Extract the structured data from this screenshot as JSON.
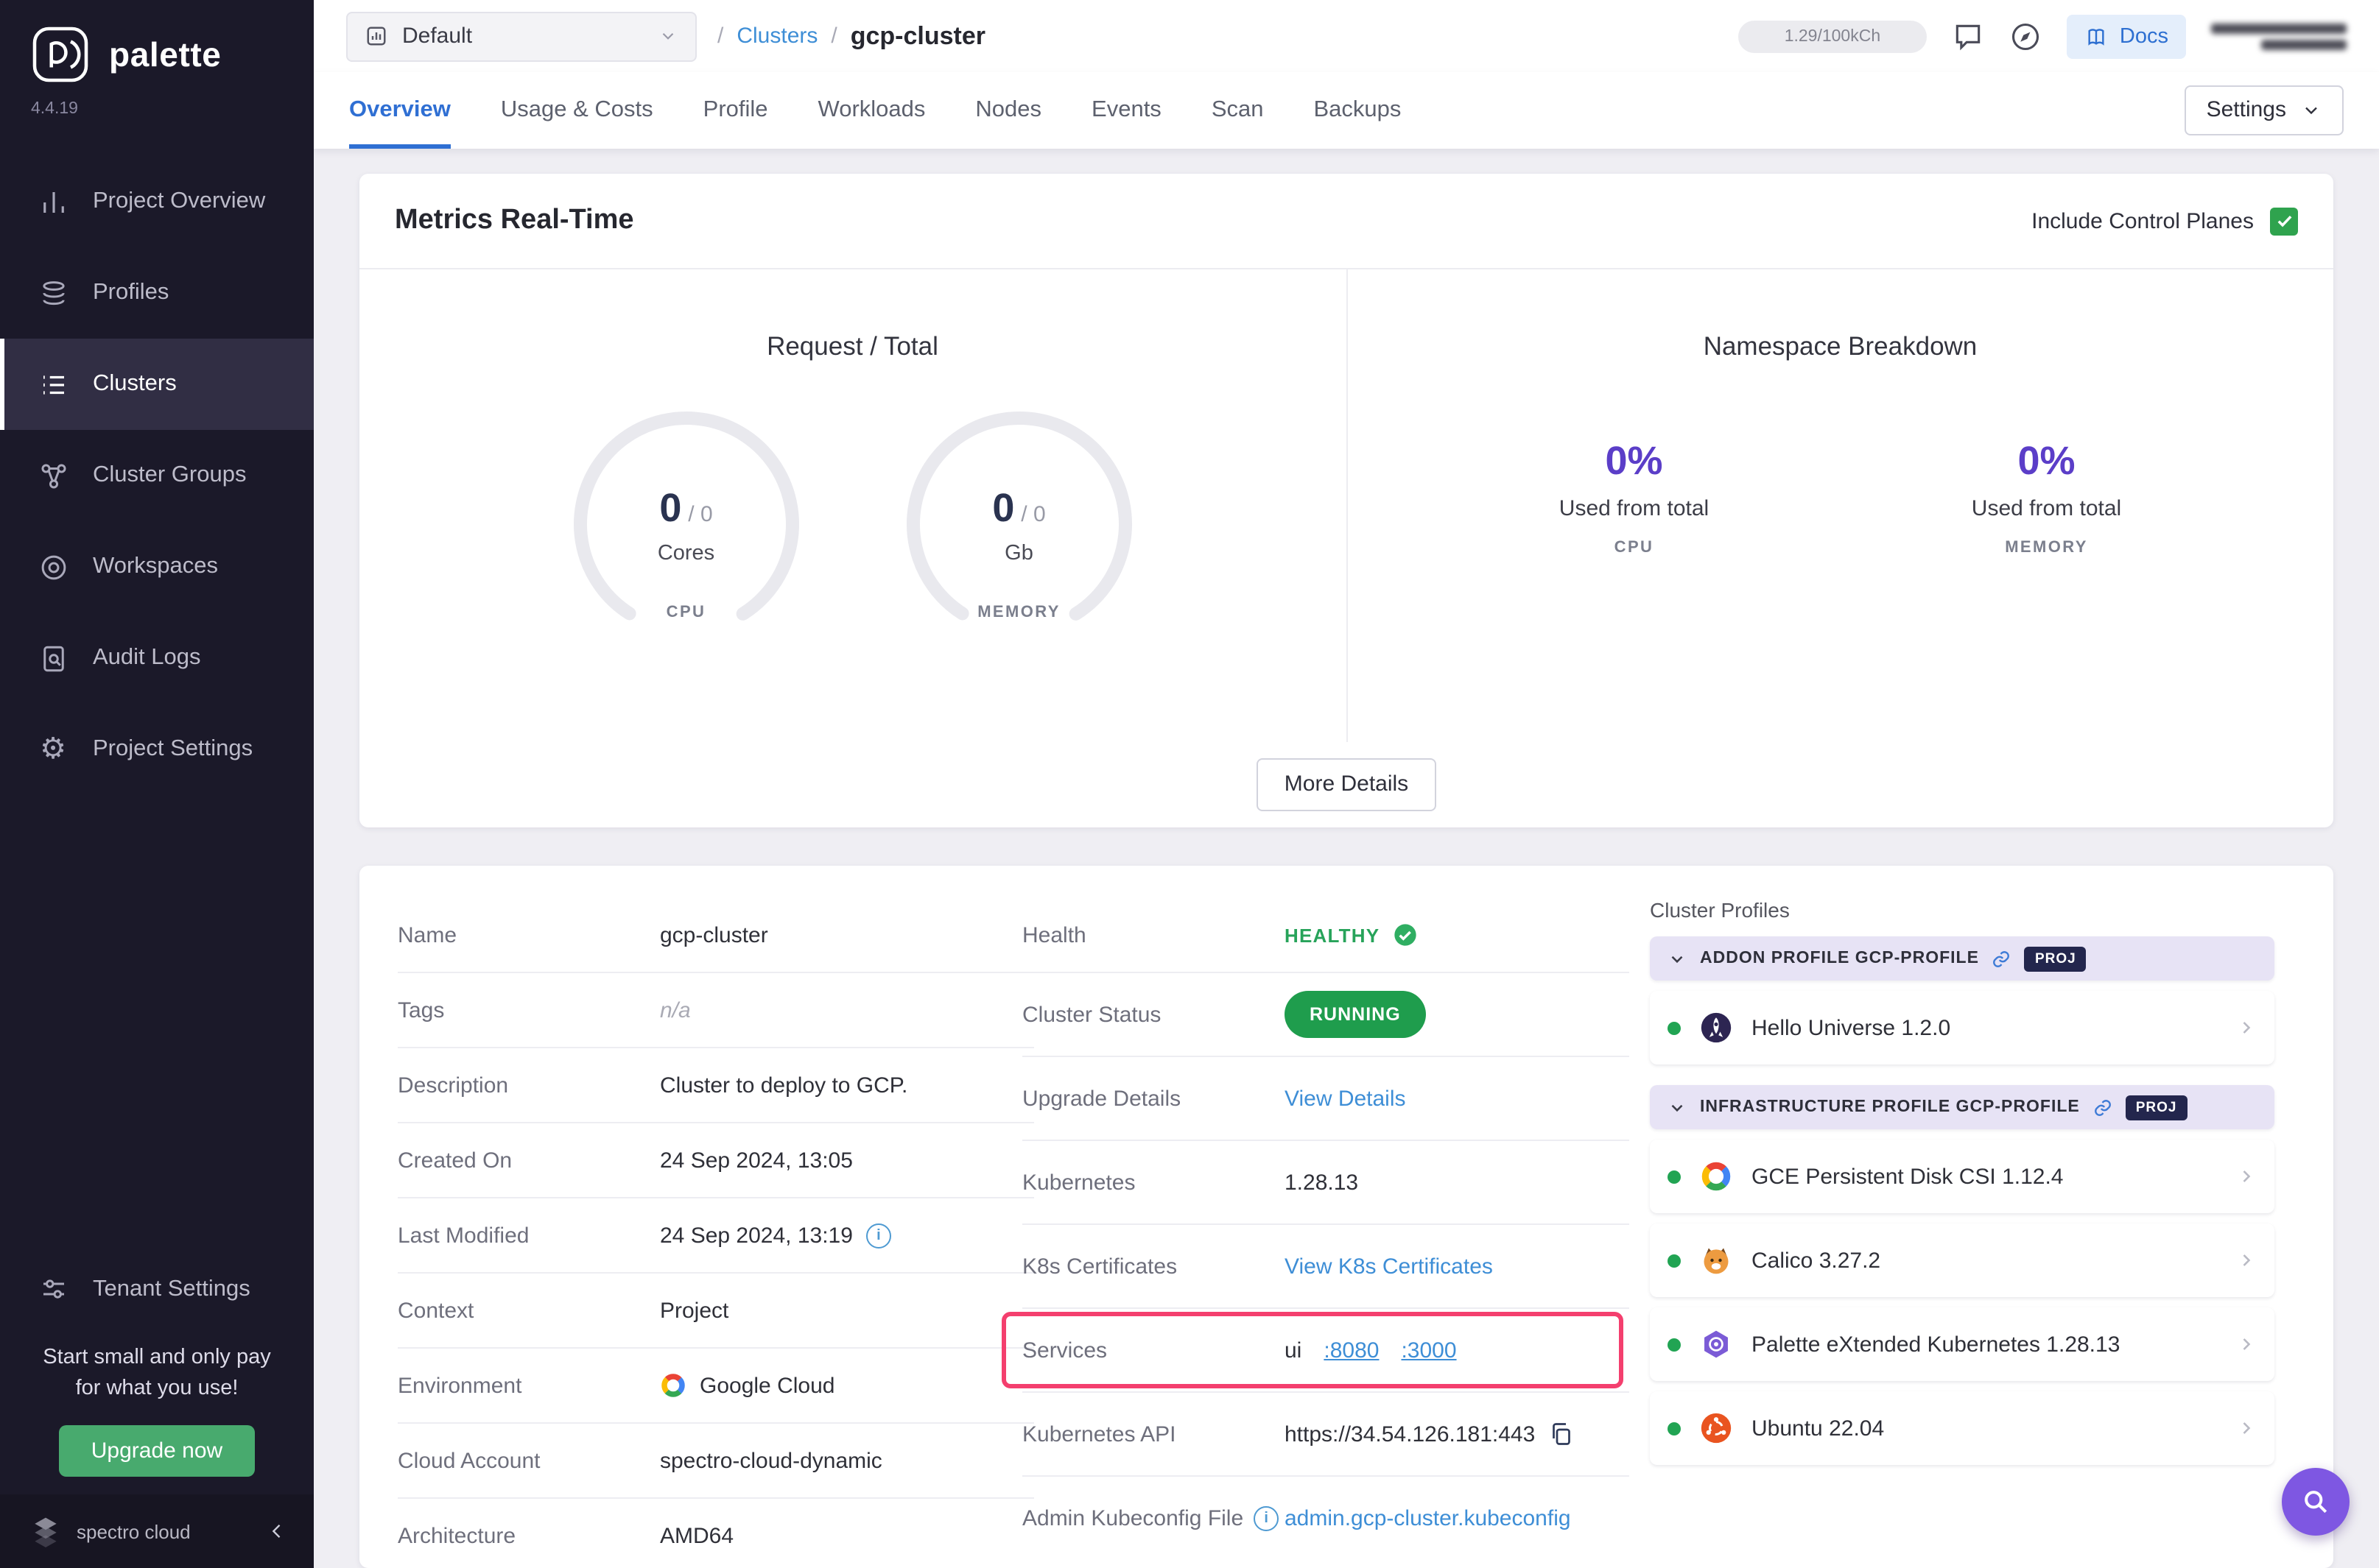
{
  "colors": {
    "sidebar_bg": "#1b1929",
    "accent_blue": "#3e8ed6",
    "tab_blue": "#2f6fd3",
    "stat_purple": "#5b3ec8",
    "status_green": "#1f9d4d",
    "healthy_green": "#27a35a",
    "annotation_pink": "#f43f6e",
    "upgrade_green": "#48aa6e",
    "checkbox_green": "#2fa34e"
  },
  "sidebar": {
    "brand": "palette",
    "version": "4.4.19",
    "items": [
      {
        "label": "Project Overview"
      },
      {
        "label": "Profiles"
      },
      {
        "label": "Clusters"
      },
      {
        "label": "Cluster Groups"
      },
      {
        "label": "Workspaces"
      },
      {
        "label": "Audit Logs"
      },
      {
        "label": "Project Settings"
      }
    ],
    "tenant": "Tenant Settings",
    "promo": {
      "line1": "Start small and only pay",
      "line2": "for what you use!",
      "cta": "Upgrade now"
    },
    "footer_brand": "spectro cloud"
  },
  "header": {
    "selector": "Default",
    "sep": "/",
    "crumb_parent": "Clusters",
    "crumb_current": "gcp-cluster",
    "usage": "1.29/100kCh",
    "docs": "Docs"
  },
  "tabs": {
    "list": [
      "Overview",
      "Usage & Costs",
      "Profile",
      "Workloads",
      "Nodes",
      "Events",
      "Scan",
      "Backups"
    ],
    "active": "Overview",
    "settings": "Settings"
  },
  "metrics": {
    "title": "Metrics Real-Time",
    "include_control_planes": "Include Control Planes",
    "request_total": {
      "title": "Request / Total",
      "gauges": [
        {
          "value": "0",
          "total": "/ 0",
          "unit": "Cores",
          "metric": "CPU"
        },
        {
          "value": "0",
          "total": "/ 0",
          "unit": "Gb",
          "metric": "MEMORY"
        }
      ]
    },
    "namespace": {
      "title": "Namespace Breakdown",
      "stats": [
        {
          "percent": "0%",
          "caption": "Used from total",
          "metric": "CPU"
        },
        {
          "percent": "0%",
          "caption": "Used from total",
          "metric": "MEMORY"
        }
      ]
    },
    "more_details": "More Details"
  },
  "details": {
    "left": [
      {
        "label": "Name",
        "value": "gcp-cluster"
      },
      {
        "label": "Tags",
        "value": "n/a"
      },
      {
        "label": "Description",
        "value": "Cluster to deploy to GCP."
      },
      {
        "label": "Created On",
        "value": "24 Sep 2024, 13:05"
      },
      {
        "label": "Last Modified",
        "value": "24 Sep 2024, 13:19"
      },
      {
        "label": "Context",
        "value": "Project"
      },
      {
        "label": "Environment",
        "value": "Google Cloud"
      },
      {
        "label": "Cloud Account",
        "value": "spectro-cloud-dynamic"
      },
      {
        "label": "Architecture",
        "value": "AMD64"
      }
    ],
    "right": {
      "health_label": "Health",
      "health_value": "HEALTHY",
      "status_label": "Cluster Status",
      "status_value": "RUNNING",
      "upgrade_label": "Upgrade Details",
      "upgrade_link": "View Details",
      "kubernetes_label": "Kubernetes",
      "kubernetes_value": "1.28.13",
      "certs_label": "K8s Certificates",
      "certs_link": "View K8s Certificates",
      "services_label": "Services",
      "services_name": "ui",
      "services_ports": [
        ":8080",
        ":3000"
      ],
      "api_label": "Kubernetes API",
      "api_value": "https://34.54.126.181:443",
      "kubeconfig_label": "Admin Kubeconfig File",
      "kubeconfig_link": "admin.gcp-cluster.kubeconfig"
    }
  },
  "profiles_panel": {
    "title": "Cluster Profiles",
    "groups": [
      {
        "header": "ADDON PROFILE GCP-PROFILE",
        "badge": "PROJ",
        "items": [
          {
            "name": "Hello Universe 1.2.0"
          }
        ]
      },
      {
        "header": "INFRASTRUCTURE PROFILE GCP-PROFILE",
        "badge": "PROJ",
        "items": [
          {
            "name": "GCE Persistent Disk CSI 1.12.4"
          },
          {
            "name": "Calico 3.27.2"
          },
          {
            "name": "Palette eXtended Kubernetes 1.28.13"
          },
          {
            "name": "Ubuntu 22.04"
          }
        ]
      }
    ]
  }
}
